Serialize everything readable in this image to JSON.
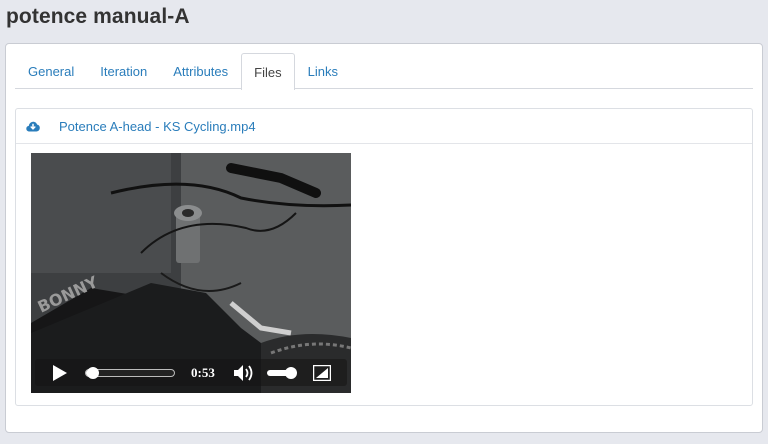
{
  "page": {
    "title": "potence manual-A"
  },
  "tabs": [
    {
      "label": "General",
      "active": false
    },
    {
      "label": "Iteration",
      "active": false
    },
    {
      "label": "Attributes",
      "active": false
    },
    {
      "label": "Files",
      "active": true
    },
    {
      "label": "Links",
      "active": false
    }
  ],
  "files": [
    {
      "name": "Potence A-head - KS Cycling.mp4",
      "icon": "cloud-download-icon",
      "player": {
        "time": "0:53",
        "progress": 0.08,
        "volume": 0.85
      }
    }
  ],
  "colors": {
    "link": "#2a7dbb",
    "page_bg": "#e6e8ee",
    "title": "#333333"
  }
}
